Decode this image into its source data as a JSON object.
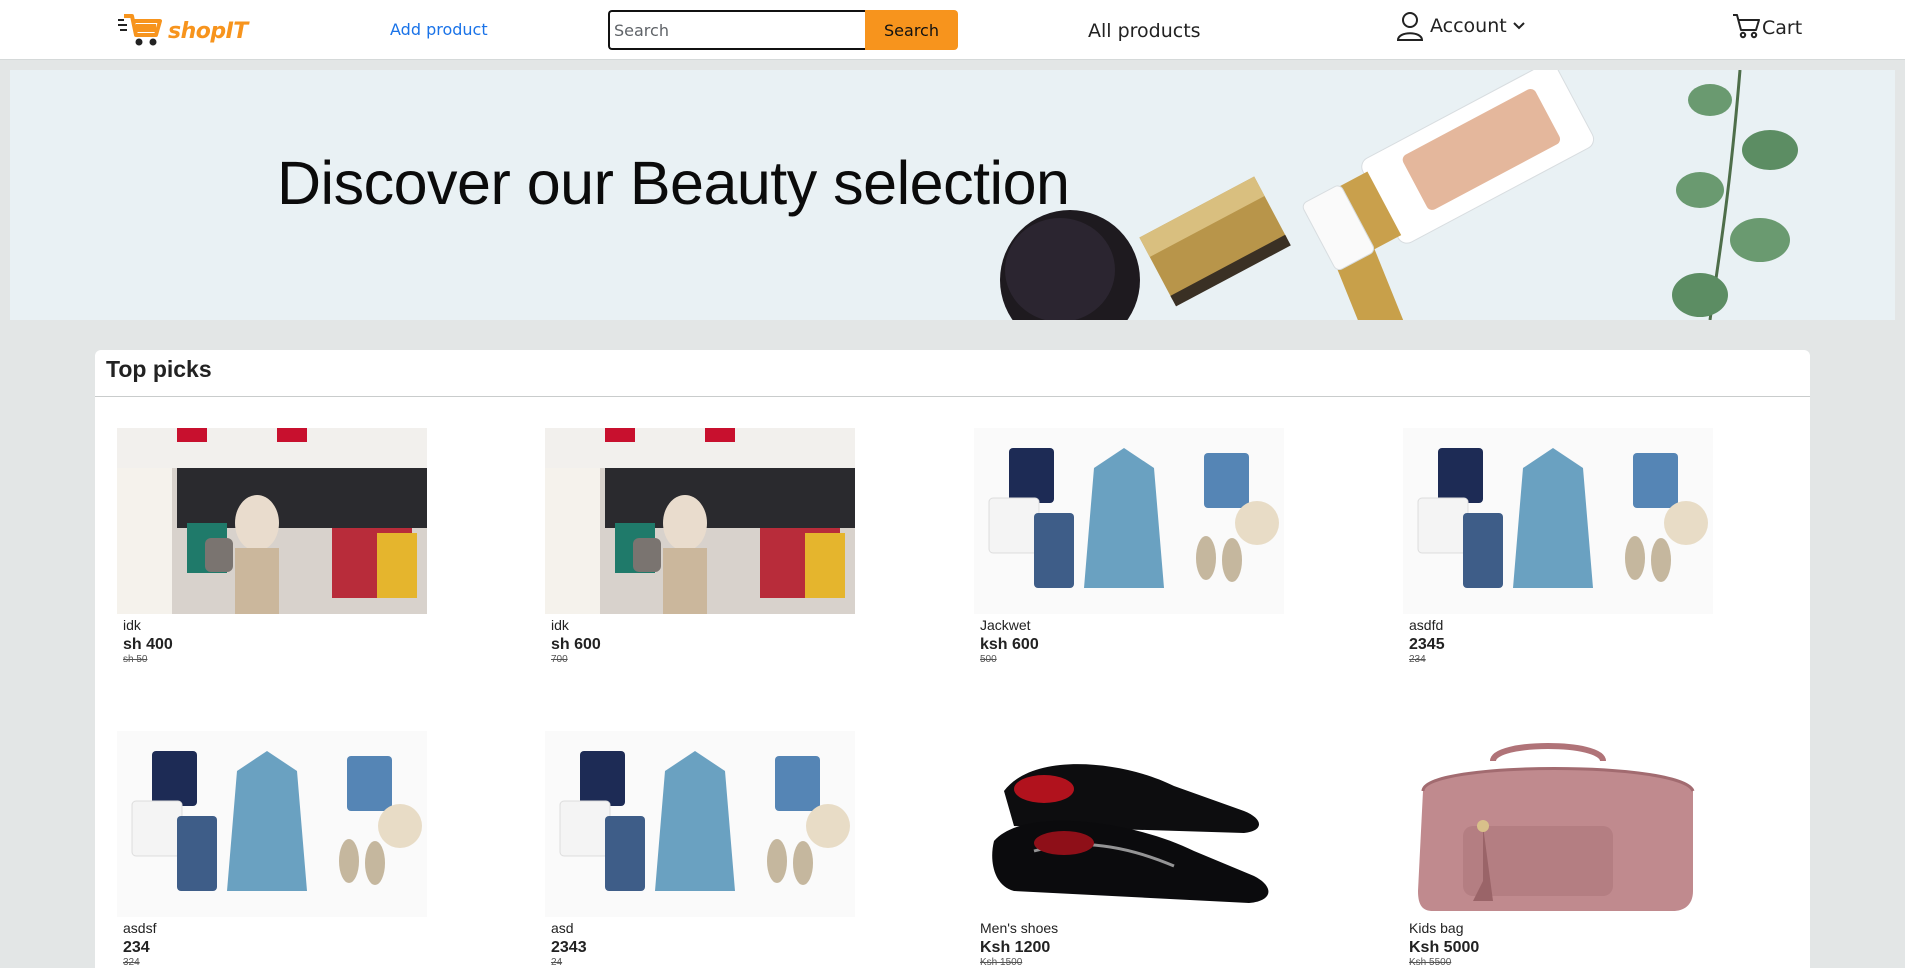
{
  "header": {
    "logo_text": "shopIT",
    "add_product_label": "Add product",
    "search": {
      "placeholder": "Search",
      "value": "",
      "button_label": "Search"
    },
    "all_products_label": "All products",
    "account_label": "Account",
    "cart_label": "Cart"
  },
  "banner": {
    "headline": "Discover our Beauty selection"
  },
  "top_picks": {
    "title": "Top picks",
    "products": [
      {
        "name": "idk",
        "price": "sh 400",
        "old_price": "sh 50",
        "image": "store-interior"
      },
      {
        "name": "idk",
        "price": "sh 600",
        "old_price": "700",
        "image": "store-interior"
      },
      {
        "name": "Jackwet",
        "price": "ksh 600",
        "old_price": "500",
        "image": "clothing-flatlay"
      },
      {
        "name": "asdfd",
        "price": "2345",
        "old_price": "234",
        "image": "clothing-flatlay"
      },
      {
        "name": "asdsf",
        "price": "234",
        "old_price": "324",
        "image": "clothing-flatlay"
      },
      {
        "name": "asd",
        "price": "2343",
        "old_price": "24",
        "image": "clothing-flatlay"
      },
      {
        "name": "Men's shoes",
        "price": "Ksh 1200",
        "old_price": "Ksh 1500",
        "image": "patent-shoes"
      },
      {
        "name": "Kids bag",
        "price": "Ksh 5000",
        "old_price": "Ksh 5500",
        "image": "pink-bag"
      }
    ]
  },
  "colors": {
    "accent": "#f7941d",
    "link": "#1a73e8",
    "page_bg": "#e3e6e6"
  }
}
